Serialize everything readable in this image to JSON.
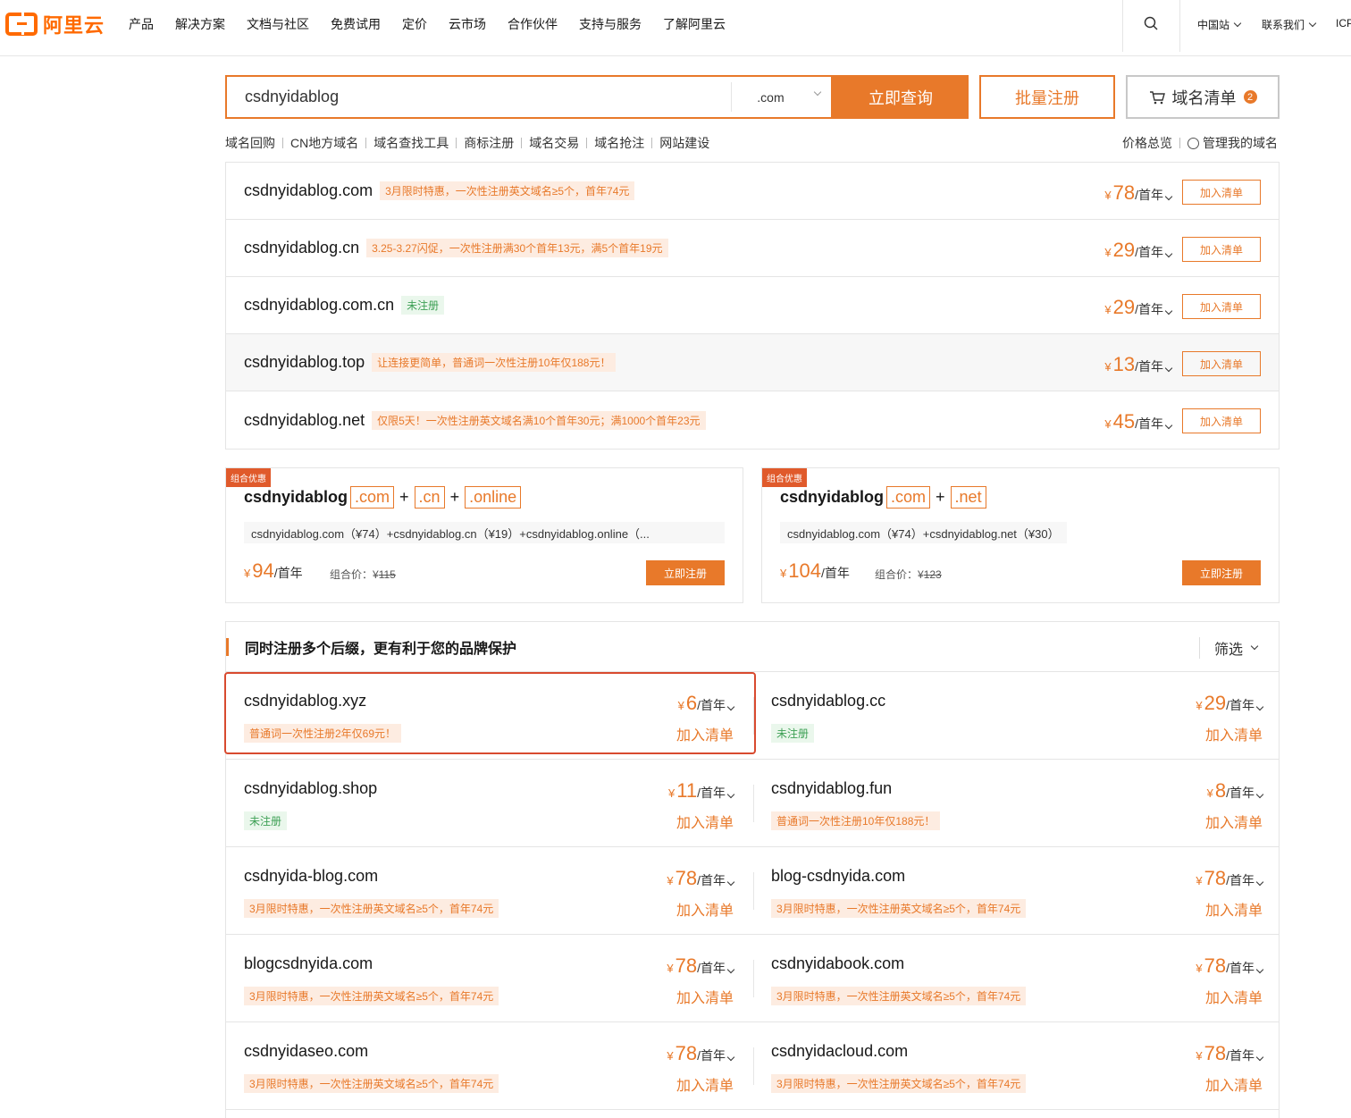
{
  "nav": {
    "logo_text": "阿里云",
    "items": [
      "产品",
      "解决方案",
      "文档与社区",
      "免费试用",
      "定价",
      "云市场",
      "合作伙伴",
      "支持与服务",
      "了解阿里云"
    ],
    "site": "中国站",
    "contact": "联系我们",
    "icp": "ICP"
  },
  "search": {
    "value": "csdnyidablog",
    "suffix": ".com",
    "query_label": "立即查询",
    "batch_label": "批量注册",
    "list_label": "域名清单",
    "list_count": "2"
  },
  "sublinks": [
    "域名回购",
    "CN地方域名",
    "域名查找工具",
    "商标注册",
    "域名交易",
    "域名抢注",
    "网站建设"
  ],
  "sublinks_right": {
    "price_overview": "价格总览",
    "manage": "管理我的域名"
  },
  "results": [
    {
      "domain": "csdnyidablog.com",
      "tag": "3月限时特惠，一次性注册英文域名≥5个，首年74元",
      "tag_type": "promo",
      "yen": "¥",
      "price": "78",
      "per": "/首年",
      "add": "加入清单"
    },
    {
      "domain": "csdnyidablog.cn",
      "tag": "3.25-3.27闪促，一次性注册满30个首年13元，满5个首年19元",
      "tag_type": "promo",
      "yen": "¥",
      "price": "29",
      "per": "/首年",
      "add": "加入清单"
    },
    {
      "domain": "csdnyidablog.com.cn",
      "tag": "未注册",
      "tag_type": "green",
      "yen": "¥",
      "price": "29",
      "per": "/首年",
      "add": "加入清单"
    },
    {
      "domain": "csdnyidablog.top",
      "tag": "让连接更简单，普通词一次性注册10年仅188元！",
      "tag_type": "promo",
      "yen": "¥",
      "price": "13",
      "per": "/首年",
      "add": "加入清单"
    },
    {
      "domain": "csdnyidablog.net",
      "tag": "仅限5天！一次性注册英文域名满10个首年30元；满1000个首年23元",
      "tag_type": "promo",
      "yen": "¥",
      "price": "45",
      "per": "/首年",
      "add": "加入清单"
    }
  ],
  "combos": [
    {
      "tag": "组合优惠",
      "base": "csdnyidablog",
      "exts": [
        ".com",
        ".cn",
        ".online"
      ],
      "desc": "csdnyidablog.com（¥74）+csdnyidablog.cn（¥19）+csdnyidablog.online（...",
      "yen": "¥",
      "price": "94",
      "per": "/首年",
      "orig_label": "组合价：¥",
      "orig_price": "115",
      "btn": "立即注册"
    },
    {
      "tag": "组合优惠",
      "base": "csdnyidablog",
      "exts": [
        ".com",
        ".net"
      ],
      "desc": "csdnyidablog.com（¥74）+csdnyidablog.net（¥30）",
      "yen": "¥",
      "price": "104",
      "per": "/首年",
      "orig_label": "组合价：¥",
      "orig_price": "123",
      "btn": "立即注册"
    }
  ],
  "multi": {
    "title": "同时注册多个后缀，更有利于您的品牌保护",
    "filter": "筛选",
    "cells": [
      {
        "domain": "csdnyidablog.xyz",
        "tag": "普通词一次性注册2年仅69元！",
        "tag_type": "promo",
        "price": "6",
        "add": "加入清单"
      },
      {
        "domain": "csdnyidablog.cc",
        "tag": "未注册",
        "tag_type": "green",
        "price": "29",
        "add": "加入清单"
      },
      {
        "domain": "csdnyidablog.shop",
        "tag": "未注册",
        "tag_type": "green",
        "price": "11",
        "add": "加入清单"
      },
      {
        "domain": "csdnyidablog.fun",
        "tag": "普通词一次性注册10年仅188元！",
        "tag_type": "promo",
        "price": "8",
        "add": "加入清单"
      },
      {
        "domain": "csdnyida-blog.com",
        "tag": "3月限时特惠，一次性注册英文域名≥5个，首年74元",
        "tag_type": "promo",
        "price": "78",
        "add": "加入清单"
      },
      {
        "domain": "blog-csdnyida.com",
        "tag": "3月限时特惠，一次性注册英文域名≥5个，首年74元",
        "tag_type": "promo",
        "price": "78",
        "add": "加入清单"
      },
      {
        "domain": "blogcsdnyida.com",
        "tag": "3月限时特惠，一次性注册英文域名≥5个，首年74元",
        "tag_type": "promo",
        "price": "78",
        "add": "加入清单"
      },
      {
        "domain": "csdnyidabook.com",
        "tag": "3月限时特惠，一次性注册英文域名≥5个，首年74元",
        "tag_type": "promo",
        "price": "78",
        "add": "加入清单"
      },
      {
        "domain": "csdnyidaseo.com",
        "tag": "3月限时特惠，一次性注册英文域名≥5个，首年74元",
        "tag_type": "promo",
        "price": "78",
        "add": "加入清单"
      },
      {
        "domain": "csdnyidacloud.com",
        "tag": "3月限时特惠，一次性注册英文域名≥5个，首年74元",
        "tag_type": "promo",
        "price": "78",
        "add": "加入清单"
      }
    ],
    "yen": "¥",
    "per": "/首年"
  },
  "colors": {
    "accent": "#e8792a",
    "highlight": "#d84a2f",
    "green": "#3ea055"
  }
}
